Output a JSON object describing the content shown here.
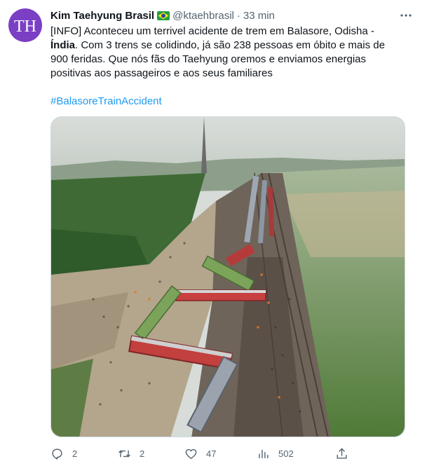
{
  "tweet": {
    "author": {
      "display_name": "Kim Taehyung Brasil",
      "flag_icon": "brazil-flag-icon",
      "handle": "@ktaehbrasil",
      "separator": "·",
      "time": "33 min",
      "avatar_text": "TH",
      "avatar_color": "#7b3fc4"
    },
    "text": {
      "line1": "[INFO] Aconteceu um terrivel acidente de trem em Balasore, Odisha -",
      "bold_word": "Índia",
      "line2_rest": ". Com 3 trens se colidindo, já são 238 pessoas em óbito e mais de",
      "line3": "900 feridas. Que nós fãs do Taehyung oremos e enviamos energias",
      "line4": "positivas aos passageiros e aos seus familiares"
    },
    "hashtag": "#BalasoreTrainAccident",
    "media": {
      "alt": "train-accident-aerial-photo"
    },
    "actions": {
      "reply_count": "2",
      "retweet_count": "2",
      "like_count": "47",
      "view_count": "502"
    },
    "colors": {
      "link": "#1d9bf0",
      "secondary_text": "#536471",
      "primary_text": "#0f1419"
    }
  }
}
